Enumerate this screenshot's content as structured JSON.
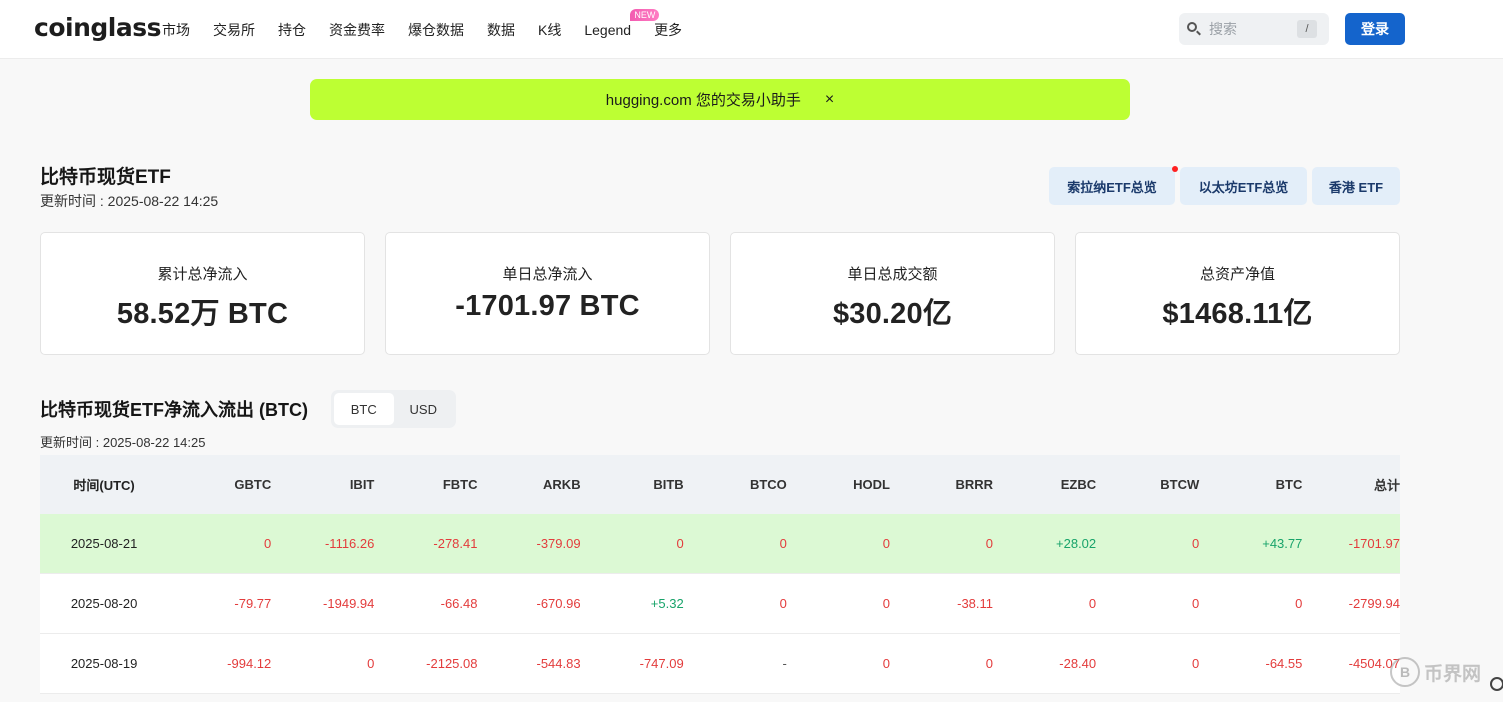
{
  "header": {
    "logo": "coinglass",
    "nav": [
      "市场",
      "交易所",
      "持仓",
      "资金费率",
      "爆仓数据",
      "数据",
      "K线",
      "Legend",
      "更多"
    ],
    "new_badge": "NEW",
    "search_placeholder": "搜索",
    "search_shortcut": "/",
    "login_label": "登录"
  },
  "banner": {
    "text": "hugging.com 您的交易小助手",
    "close": "×"
  },
  "page": {
    "title": "比特币现货ETF",
    "updated": "更新时间 : 2025-08-22 14:25",
    "buttons": [
      "索拉纳ETF总览",
      "以太坊ETF总览",
      "香港 ETF"
    ]
  },
  "stats": [
    {
      "label": "累计总净流入",
      "value": "58.52万 BTC"
    },
    {
      "label": "单日总净流入",
      "value": "-1701.97 BTC"
    },
    {
      "label": "单日总成交额",
      "value": "$30.20亿"
    },
    {
      "label": "总资产净值",
      "value": "$1468.11亿"
    }
  ],
  "flows": {
    "title": "比特币现货ETF净流入流出 (BTC)",
    "toggle": [
      "BTC",
      "USD"
    ],
    "toggle_active": "BTC",
    "updated": "更新时间 : 2025-08-22 14:25",
    "columns": [
      "时间(UTC)",
      "GBTC",
      "IBIT",
      "FBTC",
      "ARKB",
      "BITB",
      "BTCO",
      "HODL",
      "BRRR",
      "EZBC",
      "BTCW",
      "BTC",
      "总计"
    ],
    "rows": [
      [
        "2025-08-21",
        "0",
        "-1116.26",
        "-278.41",
        "-379.09",
        "0",
        "0",
        "0",
        "0",
        "+28.02",
        "0",
        "+43.77",
        "-1701.97"
      ],
      [
        "2025-08-20",
        "-79.77",
        "-1949.94",
        "-66.48",
        "-670.96",
        "+5.32",
        "0",
        "0",
        "-38.11",
        "0",
        "0",
        "0",
        "-2799.94"
      ],
      [
        "2025-08-19",
        "-994.12",
        "0",
        "-2125.08",
        "-544.83",
        "-747.09",
        "-",
        "0",
        "0",
        "-28.40",
        "0",
        "-64.55",
        "-4504.07"
      ]
    ]
  },
  "watermark": {
    "coin": "B",
    "text": "币界网"
  },
  "colors": {
    "accent": "#1464cc",
    "banner": "#bdff33",
    "negative": "#e33c3c",
    "positive": "#18a36a",
    "highlight_row": "#dcf9d4"
  }
}
